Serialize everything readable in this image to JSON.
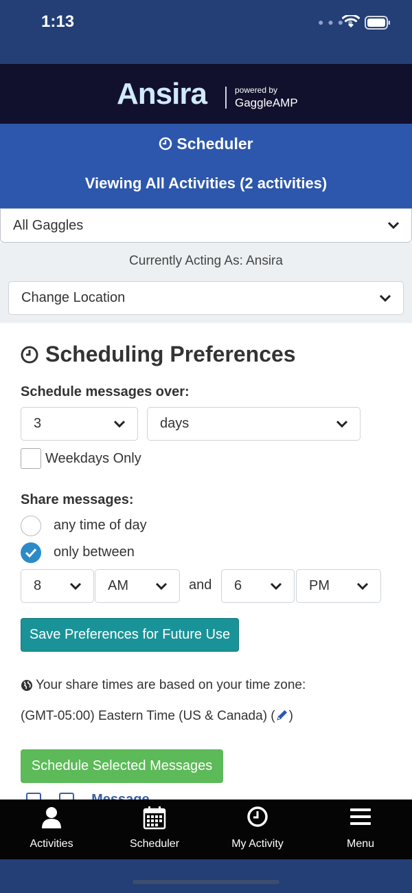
{
  "status_bar": {
    "time": "1:13"
  },
  "brand": {
    "name": "Ansira",
    "powered_by": "powered by",
    "partner": "GaggleAMP"
  },
  "header": {
    "title": "Scheduler",
    "subtitle": "Viewing All Activities (2 activities)"
  },
  "filters": {
    "gaggle_select": "All Gaggles",
    "acting_as": "Currently Acting As: Ansira",
    "location_select": "Change Location"
  },
  "preferences": {
    "title": "Scheduling Preferences",
    "schedule_over_label": "Schedule messages over:",
    "schedule_over_value": "3",
    "schedule_over_unit": "days",
    "weekdays_only_label": "Weekdays Only",
    "weekdays_only_checked": false,
    "share_label": "Share messages:",
    "option_any": "any time of day",
    "option_between": "only between",
    "selected_option": "only between",
    "start_hour": "8",
    "start_ampm": "AM",
    "and_label": "and",
    "end_hour": "6",
    "end_ampm": "PM",
    "save_button": "Save Preferences for Future Use",
    "timezone_note": "Your share times are based on your time zone:",
    "timezone_value": "(GMT-05:00) Eastern Time (US & Canada) (",
    "timezone_close": ")",
    "schedule_button": "Schedule Selected Messages",
    "partial_row_text": "Message"
  },
  "tabs": [
    {
      "label": "Activities",
      "icon": "person-icon"
    },
    {
      "label": "Scheduler",
      "icon": "calendar-icon"
    },
    {
      "label": "My Activity",
      "icon": "clock-icon"
    },
    {
      "label": "Menu",
      "icon": "hamburger-icon"
    }
  ],
  "colors": {
    "status_bg": "#243f76",
    "brand_bg": "#12112d",
    "header_bg": "#2d57ac",
    "save_button": "#1a9398",
    "schedule_button": "#5cba58",
    "radio_selected": "#2d8ac9",
    "tabbar_bg": "#050505"
  }
}
